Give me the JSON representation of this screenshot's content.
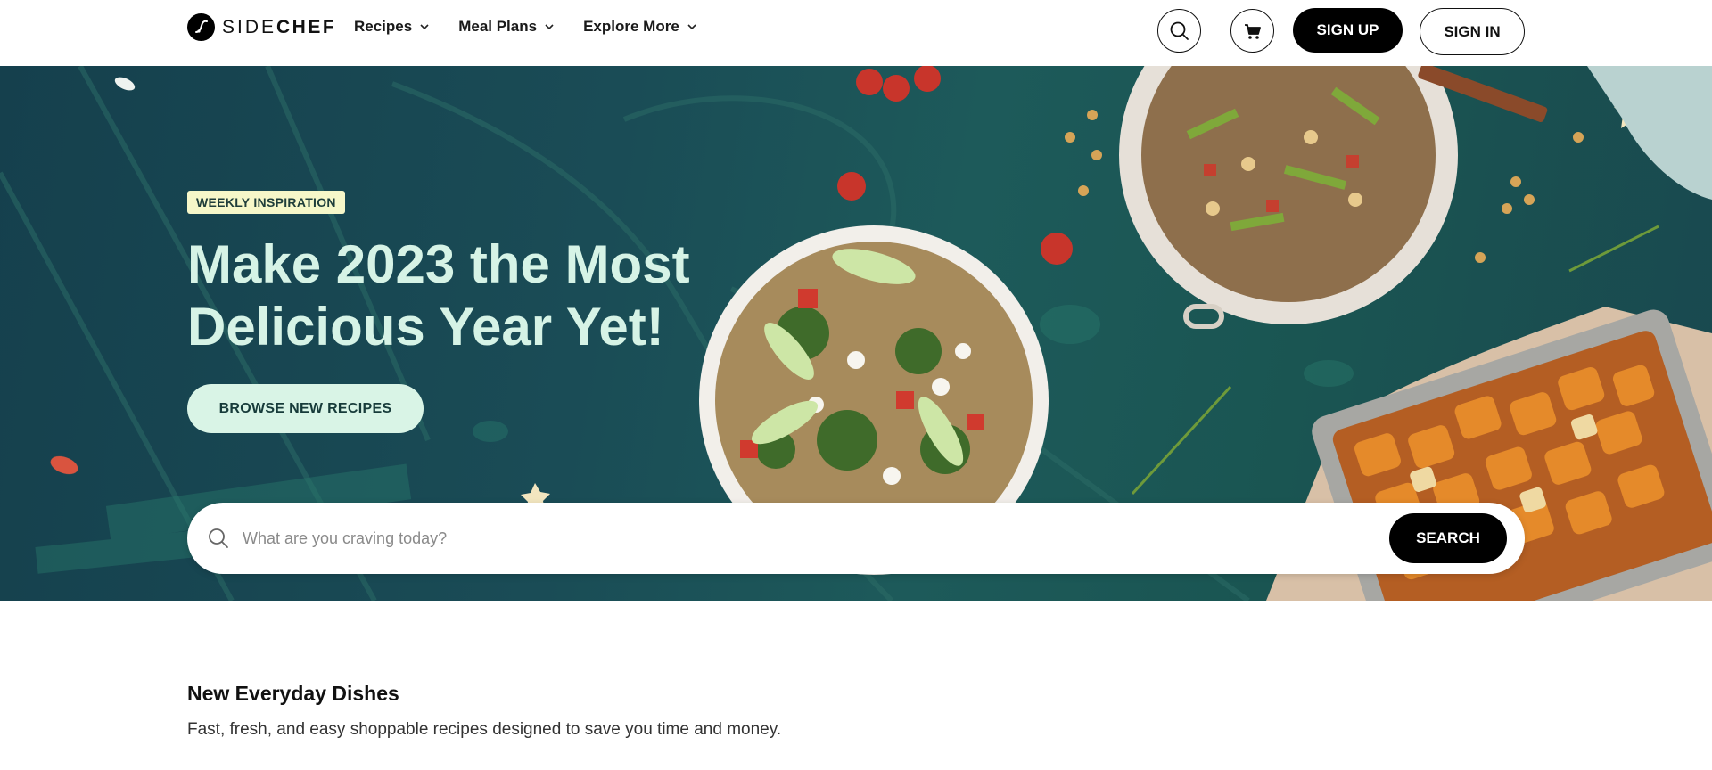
{
  "nav": {
    "logo_light": "SIDE",
    "logo_bold": "CHEF",
    "menu": [
      {
        "label": "Recipes"
      },
      {
        "label": "Meal Plans"
      },
      {
        "label": "Explore More"
      }
    ],
    "signup_label": "SIGN UP",
    "signin_label": "SIGN IN"
  },
  "hero": {
    "badge": "WEEKLY INSPIRATION",
    "headline_line1": "Make 2023 the Most",
    "headline_line2": "Delicious Year Yet!",
    "browse_label": "BROWSE NEW RECIPES",
    "search_placeholder": "What are you craving today?",
    "search_button": "SEARCH"
  },
  "section": {
    "title": "New Everyday Dishes",
    "subtitle": "Fast, fresh, and easy shoppable recipes designed to save you time and money."
  },
  "colors": {
    "hero_bg": "#1a4c56",
    "accent_mint": "#d9f4e6",
    "badge_bg": "#f6f7c9",
    "primary_button": "#000000"
  },
  "icons": [
    "sidechef-logo-icon",
    "chevron-down-icon",
    "search-icon",
    "cart-icon"
  ]
}
